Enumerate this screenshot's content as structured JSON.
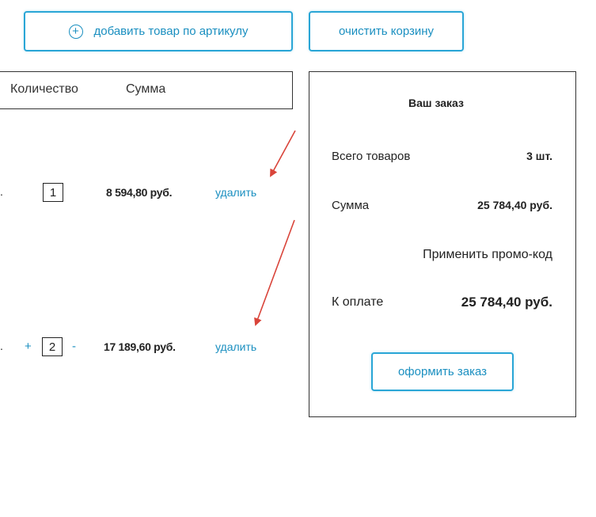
{
  "toolbar": {
    "add_by_sku_label": "добавить товар по артикулу",
    "clear_cart_label": "очистить корзину"
  },
  "table": {
    "headers": {
      "quantity": "Количество",
      "sum": "Сумма"
    },
    "rows": [
      {
        "name_fragment": ".",
        "quantity": "1",
        "sum": "8 594,80 руб.",
        "delete_label": "удалить"
      },
      {
        "name_fragment": ".",
        "increment": "+",
        "quantity": "2",
        "decrement": "-",
        "sum": "17 189,60 руб.",
        "delete_label": "удалить"
      }
    ]
  },
  "order": {
    "title": "Ваш заказ",
    "total_items_label": "Всего товаров",
    "total_items_value": "3 шт.",
    "sum_label": "Сумма",
    "sum_value": "25 784,40 руб.",
    "promo_link": "Применить промо-код",
    "to_pay_label": "К оплате",
    "to_pay_value": "25 784,40 руб.",
    "checkout_label": "оформить заказ"
  },
  "colors": {
    "accent": "#1a8fc0",
    "annotation_arrow": "#d9443a"
  }
}
